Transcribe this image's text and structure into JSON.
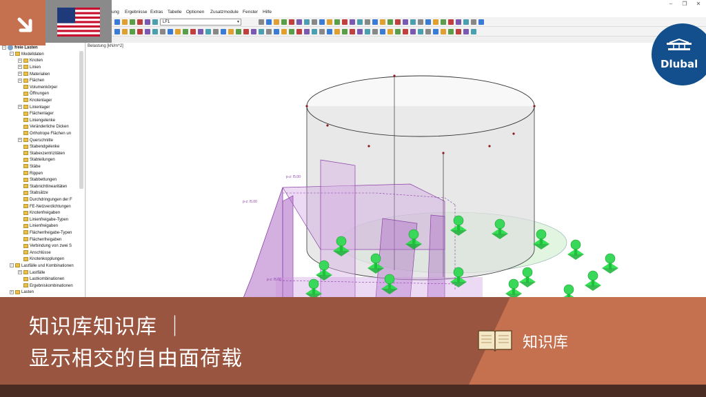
{
  "menu": [
    "Ergebnisse",
    "Extras",
    "Tabelle",
    "Optionen",
    "Zusatzmodule",
    "Fenster",
    "Hilfe"
  ],
  "menu_partial": "ung",
  "toolbar": {
    "loadcase_value": "LF1"
  },
  "navigator": {
    "root": "freie Lasten",
    "items": [
      {
        "label": "Modelldaten",
        "level": 1,
        "expand": "−"
      },
      {
        "label": "Knoten",
        "level": 2,
        "expand": "+"
      },
      {
        "label": "Linien",
        "level": 2,
        "expand": "+"
      },
      {
        "label": "Materialien",
        "level": 2,
        "expand": "+"
      },
      {
        "label": "Flächen",
        "level": 2,
        "expand": "+"
      },
      {
        "label": "Volumenkörper",
        "level": 2,
        "expand": ""
      },
      {
        "label": "Öffnungen",
        "level": 2,
        "expand": ""
      },
      {
        "label": "Knotenlager",
        "level": 2,
        "expand": ""
      },
      {
        "label": "Linienlager",
        "level": 2,
        "expand": "+"
      },
      {
        "label": "Flächenlager",
        "level": 2,
        "expand": ""
      },
      {
        "label": "Liniengelenke",
        "level": 2,
        "expand": ""
      },
      {
        "label": "Veränderliche Dicken",
        "level": 2,
        "expand": ""
      },
      {
        "label": "Orthotrope Flächen un",
        "level": 2,
        "expand": ""
      },
      {
        "label": "Querschnitte",
        "level": 2,
        "expand": "+"
      },
      {
        "label": "Stabendgelenke",
        "level": 2,
        "expand": ""
      },
      {
        "label": "Stabexzentrizitäten",
        "level": 2,
        "expand": ""
      },
      {
        "label": "Stabteilungen",
        "level": 2,
        "expand": ""
      },
      {
        "label": "Stäbe",
        "level": 2,
        "expand": ""
      },
      {
        "label": "Rippen",
        "level": 2,
        "expand": ""
      },
      {
        "label": "Stabbettungen",
        "level": 2,
        "expand": ""
      },
      {
        "label": "Stabnichtlinearitäten",
        "level": 2,
        "expand": ""
      },
      {
        "label": "Stabsätze",
        "level": 2,
        "expand": ""
      },
      {
        "label": "Durchdringungen der F",
        "level": 2,
        "expand": ""
      },
      {
        "label": "FE-Netzverdichtungen",
        "level": 2,
        "expand": ""
      },
      {
        "label": "Knotenfreigaben",
        "level": 2,
        "expand": ""
      },
      {
        "label": "Linienfreigabe-Typen",
        "level": 2,
        "expand": ""
      },
      {
        "label": "Linienfreigaben",
        "level": 2,
        "expand": ""
      },
      {
        "label": "Flächenfreigabe-Typen",
        "level": 2,
        "expand": ""
      },
      {
        "label": "Flächenfreigaben",
        "level": 2,
        "expand": ""
      },
      {
        "label": "Verbindung von zwei S",
        "level": 2,
        "expand": ""
      },
      {
        "label": "Anschlüsse",
        "level": 2,
        "expand": ""
      },
      {
        "label": "Knotenkopplungen",
        "level": 2,
        "expand": ""
      },
      {
        "label": "Lastfälle und Kombinationen",
        "level": 1,
        "expand": "−"
      },
      {
        "label": "Lastfälle",
        "level": 2,
        "expand": "+"
      },
      {
        "label": "Lastkombinationen",
        "level": 2,
        "expand": ""
      },
      {
        "label": "Ergebniskombinationen",
        "level": 2,
        "expand": ""
      },
      {
        "label": "Lasten",
        "level": 1,
        "expand": "+"
      }
    ]
  },
  "viewport": {
    "label": "Belastung [kN/m^2]",
    "load_labels": [
      "p-z: /5.00",
      "p-z: /5.00",
      "p-z: /5.00"
    ]
  },
  "brand": {
    "logo_text": "Dlubal"
  },
  "banner": {
    "line1": "知识库知识库 ｜",
    "line2": "显示相交的自由面荷载",
    "category": "知识库"
  },
  "colors": {
    "accent": "#c5704f",
    "banner": "#9a5540",
    "brand_blue": "#134f8c",
    "support_green": "#22dd44",
    "load_magenta": "#b070c8"
  }
}
